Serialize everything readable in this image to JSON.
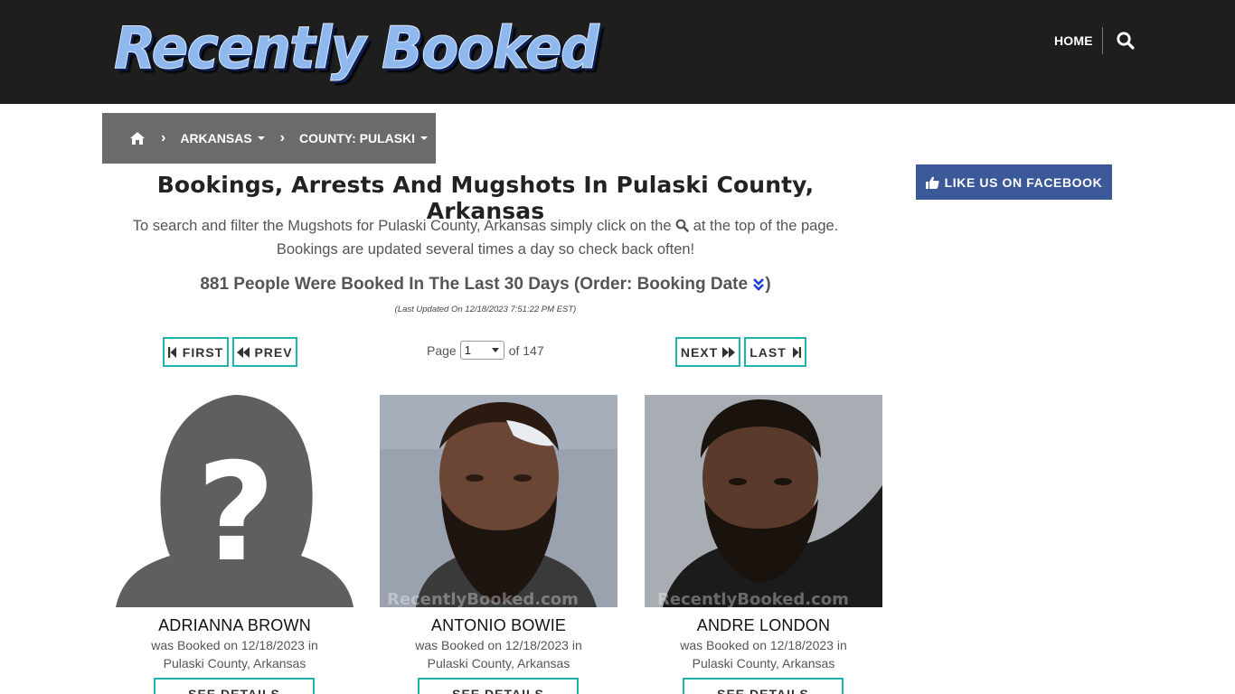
{
  "site": {
    "logo_text": "Recently Booked",
    "nav_home": "HOME"
  },
  "breadcrumb": {
    "state": "ARKANSAS",
    "county": "COUNTY: PULASKI"
  },
  "facebook": {
    "label": "LIKE US ON FACEBOOK"
  },
  "heading": {
    "title": "Bookings, Arrests And Mugshots In Pulaski County, Arkansas",
    "intro_before": "To search and filter the Mugshots for Pulaski County, Arkansas simply click on the ",
    "intro_after": " at the top of the page.",
    "intro_line2": "Bookings are updated several times a day so check back often!",
    "count_text": "881 People Were Booked In The Last 30 Days (Order: Booking Date ",
    "count_close": ")",
    "updated": "(Last Updated On 12/18/2023 7:51:22 PM EST)"
  },
  "pager": {
    "first": "FIRST",
    "prev": "PREV",
    "next": "NEXT",
    "last": "LAST",
    "page_label": "Page",
    "current_page": "1",
    "of_label": "of 147"
  },
  "bookings": [
    {
      "name": "ADRIANNA BROWN",
      "line1": "was Booked on 12/18/2023 in",
      "line2": "Pulaski County, Arkansas",
      "button": "SEE DETAILS"
    },
    {
      "name": "ANTONIO BOWIE",
      "line1": "was Booked on 12/18/2023 in",
      "line2": "Pulaski County, Arkansas",
      "button": "SEE DETAILS"
    },
    {
      "name": "ANDRE LONDON",
      "line1": "was Booked on 12/18/2023 in",
      "line2": "Pulaski County, Arkansas",
      "button": "SEE DETAILS"
    }
  ],
  "watermark": "RecentlyBooked.com",
  "colors": {
    "header_bg": "#1e1e1e",
    "breadcrumb_bg": "#6b6b6b",
    "facebook": "#3b5998",
    "button_border": "#1fb5ac",
    "order_icon": "#1a3fd6"
  },
  "icons": {
    "home": "home-icon",
    "search": "search-icon",
    "thumbs_up": "thumbs-up-icon",
    "first": "step-backward-icon",
    "prev": "backward-icon",
    "next": "forward-icon",
    "last": "step-forward-icon",
    "order": "double-chevron-down-icon"
  }
}
